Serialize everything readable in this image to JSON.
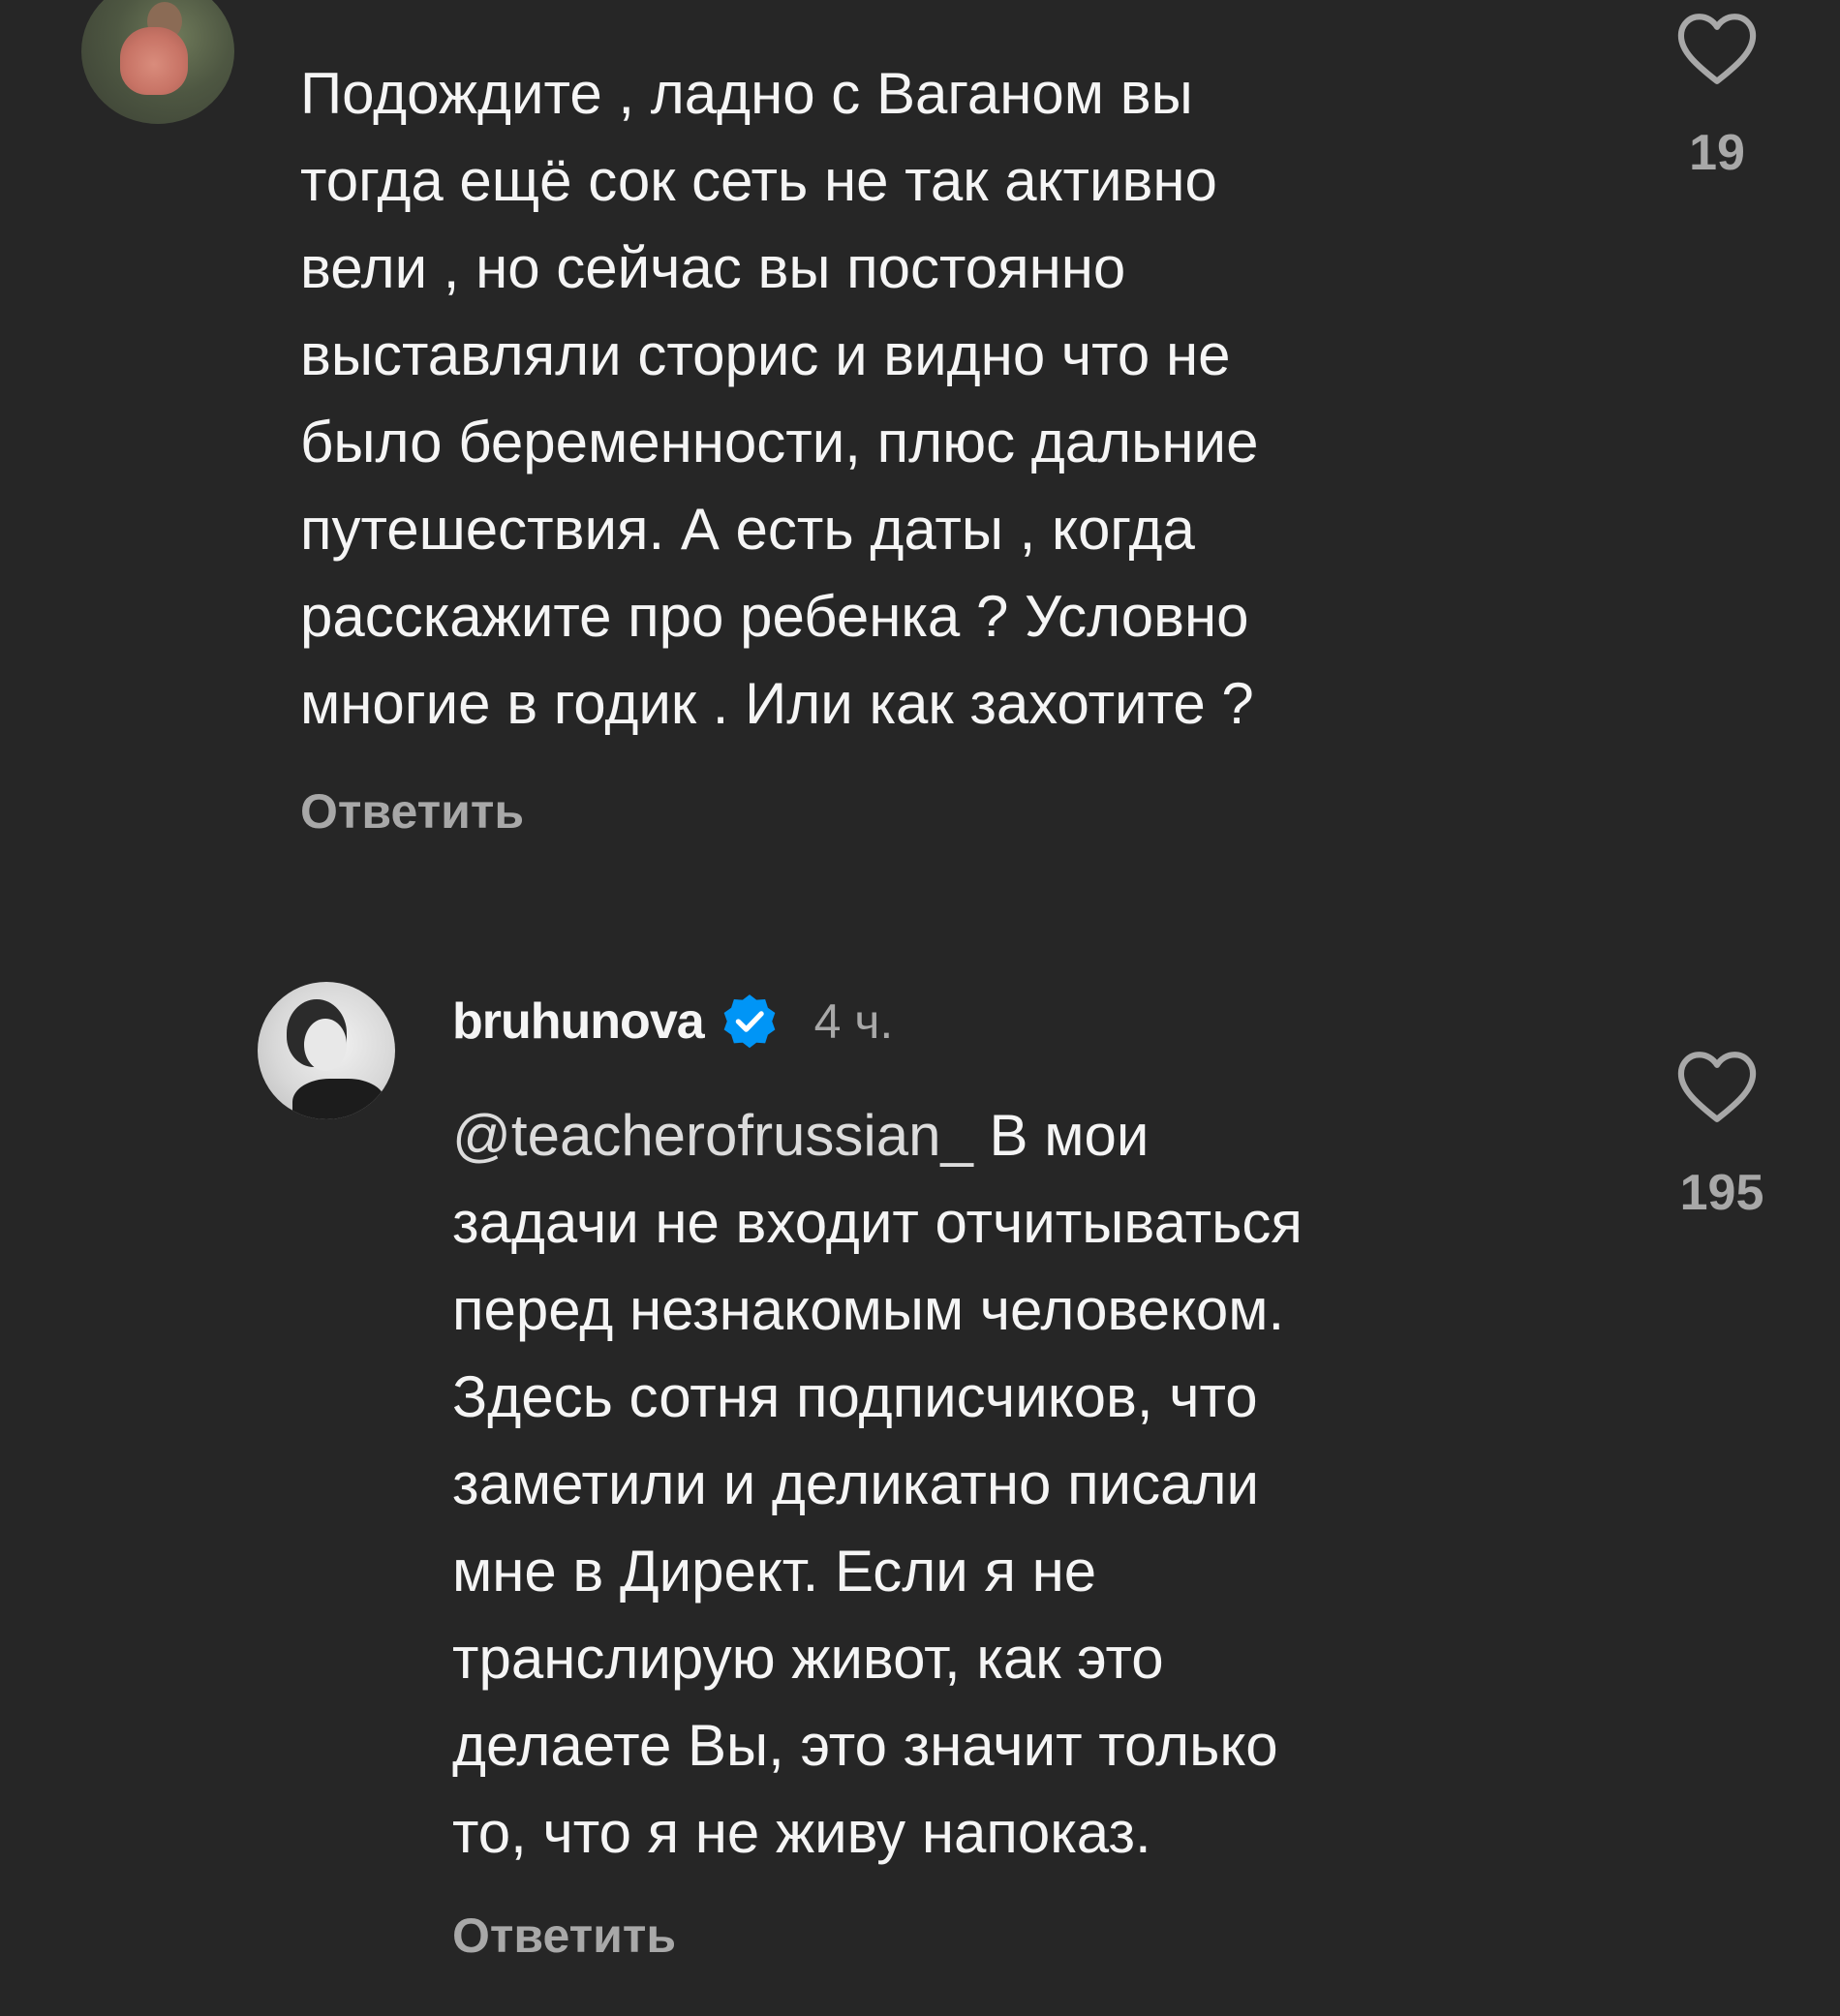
{
  "comment": {
    "lines": [
      "Подождите , ладно с Ваганом вы",
      "тогда ещё сок сеть не так активно",
      "вели , но сейчас вы постоянно",
      "выставляли сторис и видно что не",
      "было беременности, плюс дальние",
      "путешествия. А есть даты , когда",
      "расскажите про ребенка ? Условно",
      "многие в годик . Или как захотите ?"
    ],
    "reply_label": "Ответить",
    "likes": "19",
    "icons": {
      "avatar": "user-avatar",
      "like": "heart-outline-icon"
    }
  },
  "reply": {
    "username": "bruhunova",
    "timestamp": "4 ч.",
    "mention": "@teacherofrussian_",
    "lines": [
      " В мои",
      "задачи не входит отчитываться",
      "перед незнакомым человеком.",
      "Здесь сотня подписчиков, что",
      "заметили и деликатно писали",
      "мне в Директ. Если я не",
      "транслирую живот, как это",
      "делаете Вы, это значит только",
      "то, что я не живу напоказ."
    ],
    "reply_label": "Ответить",
    "likes": "195",
    "icons": {
      "avatar": "user-avatar",
      "verified": "verified-badge-icon",
      "like": "heart-outline-icon"
    }
  },
  "colors": {
    "background": "#262626",
    "text": "#f5f5f5",
    "muted": "#a8a8a8",
    "verified": "#0095f6"
  }
}
